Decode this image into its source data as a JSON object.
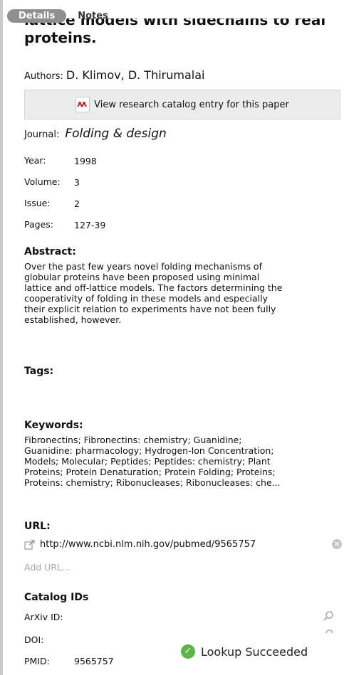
{
  "tabs": {
    "details": "Details",
    "notes": "Notes"
  },
  "title": "lattice models with sidechains to real proteins.",
  "authors": {
    "label": "Authors:",
    "value": "D. Klimov, D. Thirumalai"
  },
  "catalog_button": "View research catalog entry for this paper",
  "journal": {
    "label": "Journal:",
    "value": "Folding & design"
  },
  "fields": {
    "year": {
      "label": "Year:",
      "value": "1998"
    },
    "volume": {
      "label": "Volume:",
      "value": "3"
    },
    "issue": {
      "label": "Issue:",
      "value": "2"
    },
    "pages": {
      "label": "Pages:",
      "value": "127-39"
    }
  },
  "abstract": {
    "heading": "Abstract:",
    "lines": [
      "Over the past few years novel folding mechanisms of",
      "globular proteins have been proposed using minimal",
      "lattice and off-lattice models. The factors determining the",
      "cooperativity of folding in these models and especially",
      "their explicit relation to experiments have not been fully",
      "established, however."
    ]
  },
  "tags": {
    "heading": "Tags:"
  },
  "keywords": {
    "heading": "Keywords:",
    "lines": [
      "Fibronectins; Fibronectins: chemistry; Guanidine;",
      "Guanidine: pharmacology; Hydrogen-Ion Concentration;",
      "Models; Molecular; Peptides; Peptides: chemistry; Plant",
      "Proteins; Protein Denaturation; Protein Folding; Proteins;",
      "Proteins: chemistry; Ribonucleases; Ribonucleases: che..."
    ]
  },
  "url": {
    "heading": "URL:",
    "value": "http://www.ncbi.nlm.nih.gov/pubmed/9565757",
    "add": "Add URL..."
  },
  "catalog_ids": {
    "heading": "Catalog IDs",
    "arxiv": {
      "label": "ArXiv ID:",
      "value": ""
    },
    "doi": {
      "label": "DOI:",
      "value": ""
    },
    "pmid": {
      "label": "PMID:",
      "value": "9565757"
    }
  },
  "status": {
    "text": "Lookup Succeeded"
  }
}
